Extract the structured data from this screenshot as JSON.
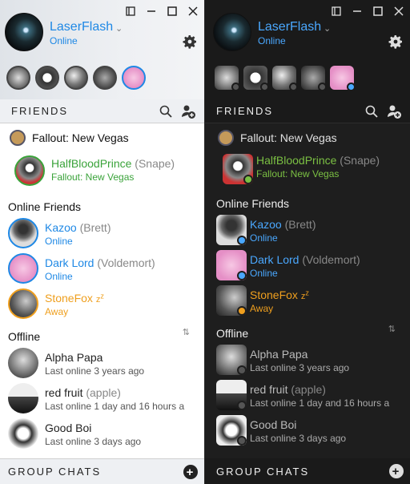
{
  "user": {
    "name": "LaserFlash",
    "status": "Online"
  },
  "friends_label": "FRIENDS",
  "group_chats_label": "GROUP CHATS",
  "in_game": {
    "game_title": "Fallout: New Vegas",
    "friend": {
      "name": "HalfBloodPrince",
      "nick": "(Snape)",
      "sub": "Fallout: New Vegas"
    }
  },
  "online_section": "Online Friends",
  "online": [
    {
      "name": "Kazoo",
      "nick": "(Brett)",
      "sub": "Online",
      "state": "online",
      "color": "#1e88e5"
    },
    {
      "name": "Dark Lord",
      "nick": "(Voldemort)",
      "sub": "Online",
      "state": "online",
      "color": "#1e88e5"
    },
    {
      "name": "StoneFox",
      "nick": "",
      "sub": "Away",
      "state": "away",
      "color": "#ef9f1e"
    }
  ],
  "offline_section": "Offline",
  "offline": [
    {
      "name": "Alpha Papa",
      "nick": "",
      "sub": "Last online 3 years ago"
    },
    {
      "name": "red fruit",
      "nick": "(apple)",
      "sub": "Last online 1 day and 16 hours a"
    },
    {
      "name": "Good Boi",
      "nick": "",
      "sub": "Last online 3 days ago"
    }
  ],
  "colors": {
    "online": "#1e88e5",
    "ingame": "#7bc043",
    "away": "#ef9f1e"
  },
  "icons": [
    "minimize-window-icon",
    "restore-window-icon",
    "maximize-icon",
    "close-icon",
    "gear-icon",
    "search-icon",
    "add-friend-icon",
    "sort-icon",
    "add-group-chat-icon"
  ]
}
